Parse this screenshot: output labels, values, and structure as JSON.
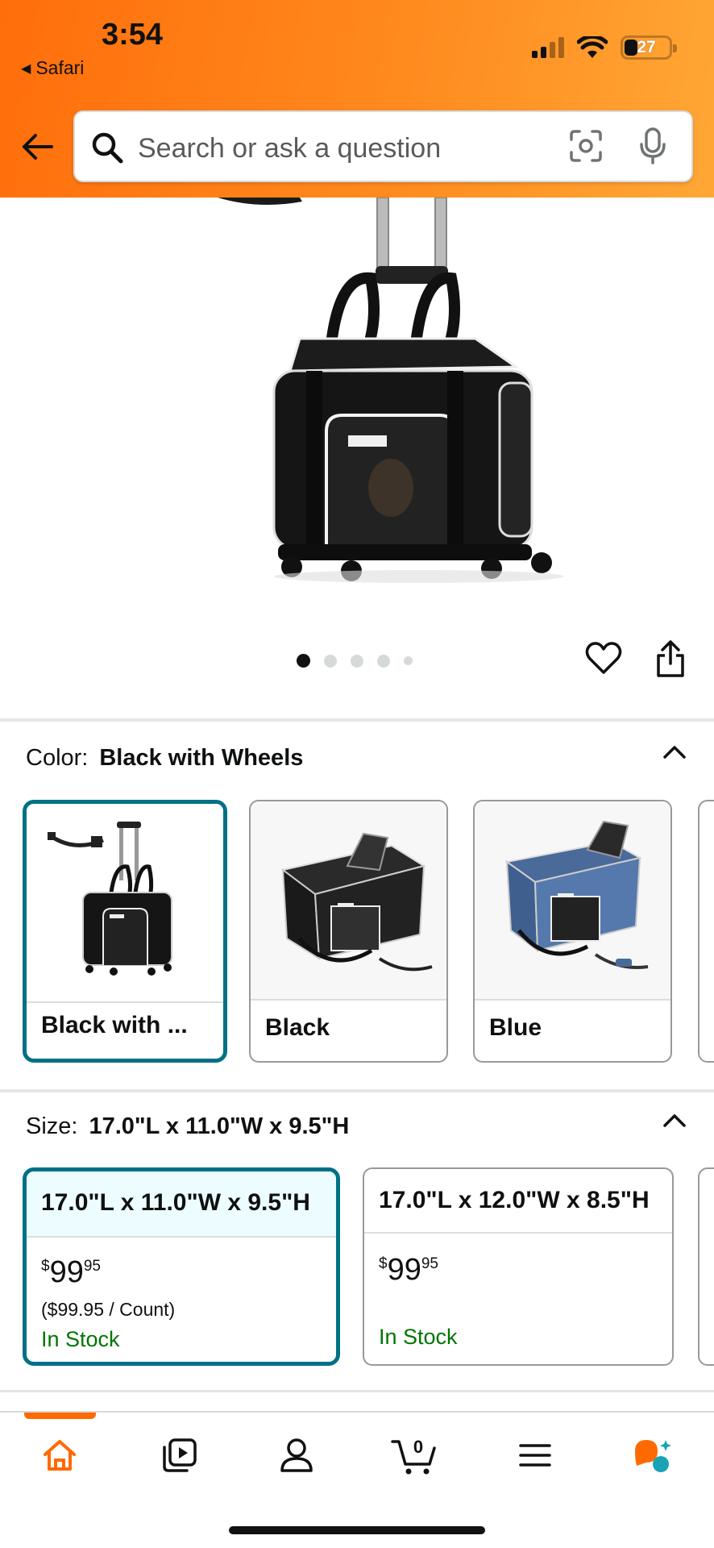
{
  "status_bar": {
    "time": "3:54",
    "back_app": "Safari",
    "battery": "27"
  },
  "search": {
    "placeholder": "Search or ask a question"
  },
  "product": {
    "image_count": 5,
    "active_image": 1
  },
  "color": {
    "label": "Color:",
    "selected": "Black with Wheels",
    "options": [
      {
        "label": "Black with ...",
        "selected": true
      },
      {
        "label": "Black",
        "selected": false
      },
      {
        "label": "Blue",
        "selected": false
      }
    ]
  },
  "size": {
    "label": "Size:",
    "selected": "17.0\"L x 11.0\"W x 9.5\"H",
    "options": [
      {
        "label": "17.0\"L x 11.0\"W x 9.5\"H",
        "currency": "$",
        "whole": "99",
        "fraction": "95",
        "unit_price": "($99.95 / Count)",
        "stock": "In Stock",
        "selected": true
      },
      {
        "label": "17.0\"L x 12.0\"W x 8.5\"H",
        "currency": "$",
        "whole": "99",
        "fraction": "95",
        "unit_price": "",
        "stock": "In Stock",
        "selected": false
      }
    ]
  },
  "nav": {
    "cart_count": "0",
    "items": [
      "home-icon",
      "video-icon",
      "account-icon",
      "cart-icon",
      "menu-icon",
      "rufus-icon"
    ]
  },
  "colors": {
    "brand_orange": "#ff8a1e",
    "selected_teal": "#007185",
    "in_stock_green": "#007600"
  }
}
